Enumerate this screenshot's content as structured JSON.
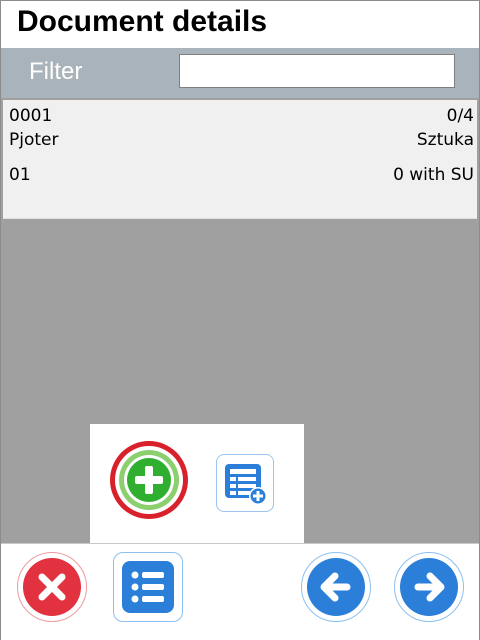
{
  "header": {
    "title": "Document details"
  },
  "filter": {
    "label": "Filter",
    "value": ""
  },
  "items": [
    {
      "code": "0001",
      "quantity": "0/4",
      "name": "Pjoter",
      "unit": "Sztuka",
      "location": "01",
      "su": "0 with SU"
    }
  ],
  "popup": {
    "add_icon": "plus-circle-icon",
    "list_add_icon": "list-add-icon"
  },
  "toolbar": {
    "cancel_icon": "close-icon",
    "list_icon": "list-icon",
    "back_icon": "arrow-left-icon",
    "forward_icon": "arrow-right-icon"
  },
  "colors": {
    "accent_blue": "#2c7fd8",
    "danger_red": "#e2323f",
    "success_green": "#2fae2f",
    "filter_bar": "#a9b3bb"
  }
}
